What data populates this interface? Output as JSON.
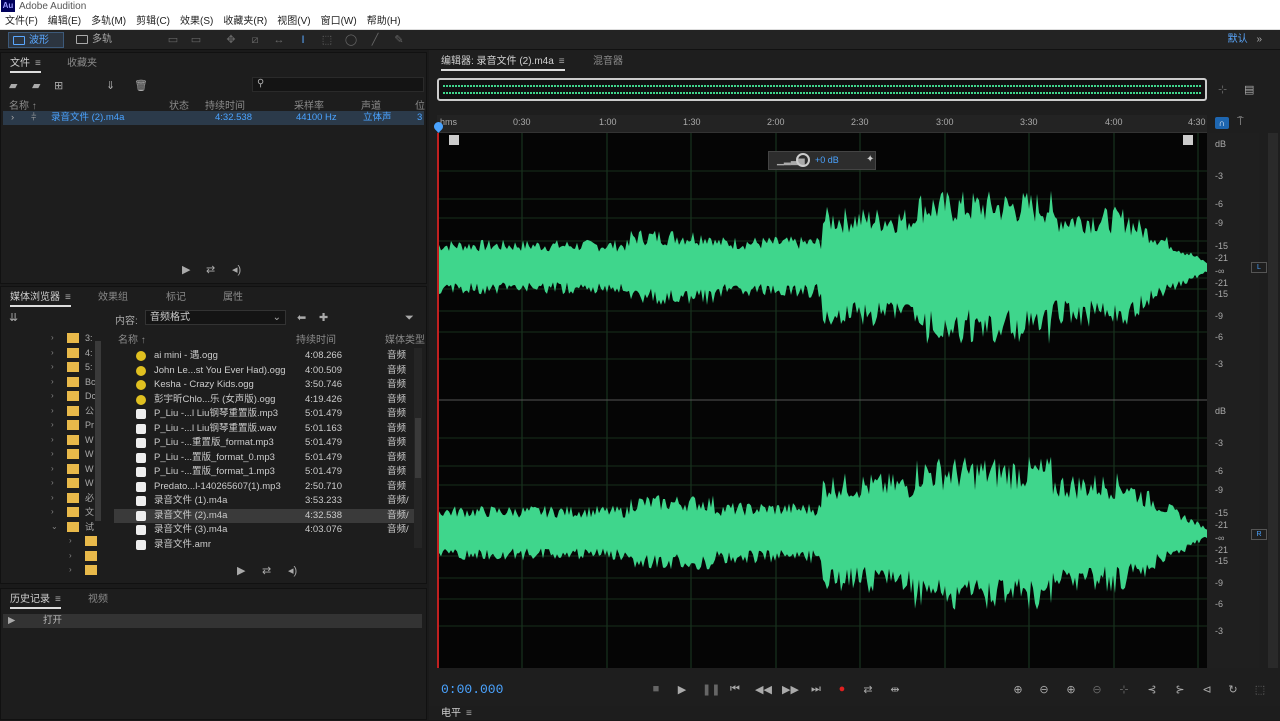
{
  "app": {
    "logo": "Au",
    "title": "Adobe Audition"
  },
  "menu": [
    "文件(F)",
    "编辑(E)",
    "多轨(M)",
    "剪辑(C)",
    "效果(S)",
    "收藏夹(R)",
    "视图(V)",
    "窗口(W)",
    "帮助(H)"
  ],
  "toolbar": {
    "mode_waveform": "波形",
    "mode_multitrack": "多轨",
    "workspace": "默认",
    "workspace_arrow": "»"
  },
  "files_panel": {
    "tabs": [
      "文件",
      "收藏夹"
    ],
    "columns": [
      "名称 ↑",
      "状态",
      "持续时间",
      "采样率",
      "声道",
      "位"
    ],
    "rows": [
      {
        "name": "录音文件 (2).m4a",
        "duration": "4:32.538",
        "rate": "44100 Hz",
        "channels": "立体声",
        "bits": "3"
      }
    ]
  },
  "media_panel": {
    "tabs": [
      "媒体浏览器",
      "效果组",
      "标记",
      "属性"
    ],
    "content_label": "内容:",
    "content_value": "音频格式",
    "col_name": "名称 ↑",
    "col_duration": "持续时间",
    "col_type": "媒体类型",
    "folders": [
      "3:",
      "4:",
      "5:",
      "Bc",
      "Dc",
      "公",
      "Pr",
      "W",
      "W",
      "W",
      "W",
      "必",
      "文",
      "试",
      "",
      "",
      ""
    ],
    "files": [
      {
        "name": "ai mini - 遇.ogg",
        "duration": "4:08.266",
        "type": "音频",
        "kind": "ogg"
      },
      {
        "name": "John Le...st You Ever Had).ogg",
        "duration": "4:00.509",
        "type": "音频",
        "kind": "ogg"
      },
      {
        "name": "Kesha - Crazy Kids.ogg",
        "duration": "3:50.746",
        "type": "音频",
        "kind": "ogg"
      },
      {
        "name": "彭宇昕Chlo...乐 (女声版).ogg",
        "duration": "4:19.426",
        "type": "音频",
        "kind": "ogg"
      },
      {
        "name": "P_Liu -...l Liu钢琴重置版.mp3",
        "duration": "5:01.479",
        "type": "音频",
        "kind": "aud"
      },
      {
        "name": "P_Liu -...l Liu钢琴重置版.wav",
        "duration": "5:01.163",
        "type": "音频",
        "kind": "aud"
      },
      {
        "name": "P_Liu -...重置版_format.mp3",
        "duration": "5:01.479",
        "type": "音频",
        "kind": "aud"
      },
      {
        "name": "P_Liu -...置版_format_0.mp3",
        "duration": "5:01.479",
        "type": "音频",
        "kind": "aud"
      },
      {
        "name": "P_Liu -...置版_format_1.mp3",
        "duration": "5:01.479",
        "type": "音频",
        "kind": "aud"
      },
      {
        "name": "Predato...l-140265607(1).mp3",
        "duration": "2:50.710",
        "type": "音频",
        "kind": "aud"
      },
      {
        "name": "录音文件 (1).m4a",
        "duration": "3:53.233",
        "type": "音频/",
        "kind": "aud"
      },
      {
        "name": "录音文件 (2).m4a",
        "duration": "4:32.538",
        "type": "音频/",
        "kind": "aud"
      },
      {
        "name": "录音文件 (3).m4a",
        "duration": "4:03.076",
        "type": "音频/",
        "kind": "aud"
      },
      {
        "name": "录音文件.amr",
        "duration": "",
        "type": "",
        "kind": "aud"
      }
    ]
  },
  "history_panel": {
    "tabs": [
      "历史记录",
      "视频"
    ],
    "entry": "打开"
  },
  "editor": {
    "tab_active": "编辑器: 录音文件 (2).m4a",
    "tab_mixer": "混音器",
    "ruler": [
      "hms",
      "0:30",
      "1:00",
      "1:30",
      "2:00",
      "2:30",
      "3:00",
      "3:30",
      "4:00",
      "4:30"
    ],
    "hud_gain": "+0 dB",
    "db_top": [
      "dB",
      "-3",
      "-6",
      "-9",
      "-15",
      "-21",
      "-∞",
      "-21",
      "-15",
      "-9",
      "-6",
      "-3"
    ],
    "db_bottom": [
      "dB",
      "-3",
      "-6",
      "-9",
      "-15",
      "-21",
      "-∞",
      "-21",
      "-15",
      "-9",
      "-6",
      "-3"
    ],
    "chan_left": "L",
    "chan_right": "R",
    "timecode": "0:00.000",
    "bottom_tab": "电平",
    "wave_color": "#3fd68c"
  }
}
